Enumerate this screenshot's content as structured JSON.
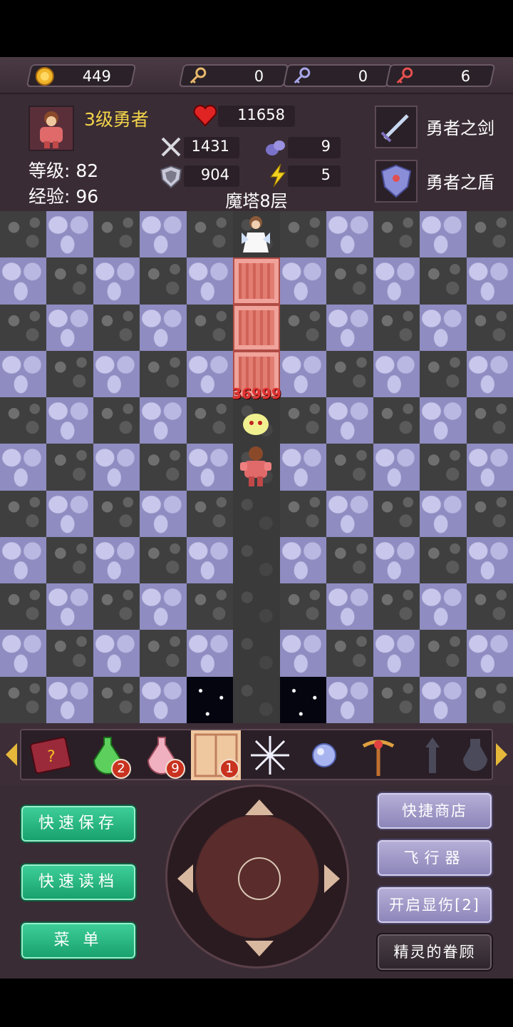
{
  "resources": {
    "gold": "449",
    "yellow_keys": "0",
    "blue_keys": "0",
    "red_keys": "6"
  },
  "hero": {
    "title": "3级勇者",
    "level_label": "等级:",
    "level": "82",
    "exp_label": "经验:",
    "exp": "96",
    "hp": "11658",
    "attack": "1431",
    "defense": "904",
    "mdef": "9",
    "speed": "5"
  },
  "equipment": {
    "weapon": "勇者之剑",
    "shield": "勇者之盾"
  },
  "floor": "魔塔8层",
  "board": {
    "enemy_damage": "36999"
  },
  "items": [
    {
      "name": "monster-book",
      "count": ""
    },
    {
      "name": "green-potion",
      "count": "2"
    },
    {
      "name": "pink-potion",
      "count": "9"
    },
    {
      "name": "door-scroll",
      "count": "1"
    },
    {
      "name": "snowflake",
      "count": ""
    },
    {
      "name": "orb",
      "count": ""
    },
    {
      "name": "cross-staff",
      "count": ""
    },
    {
      "name": "dark-figure",
      "count": ""
    },
    {
      "name": "dark-vase",
      "count": ""
    }
  ],
  "buttons": {
    "quick_save": "快速保存",
    "quick_load": "快速读档",
    "menu": "菜 单",
    "shop": "快捷商店",
    "fly": "飞行器",
    "show_damage": "开启显伤[2]",
    "fairy": "精灵的眷顾"
  },
  "colors": {
    "gold": "#f2d44a",
    "damage": "#e33333",
    "green_button": "#17a06b",
    "purple_button": "#8b84b8"
  }
}
